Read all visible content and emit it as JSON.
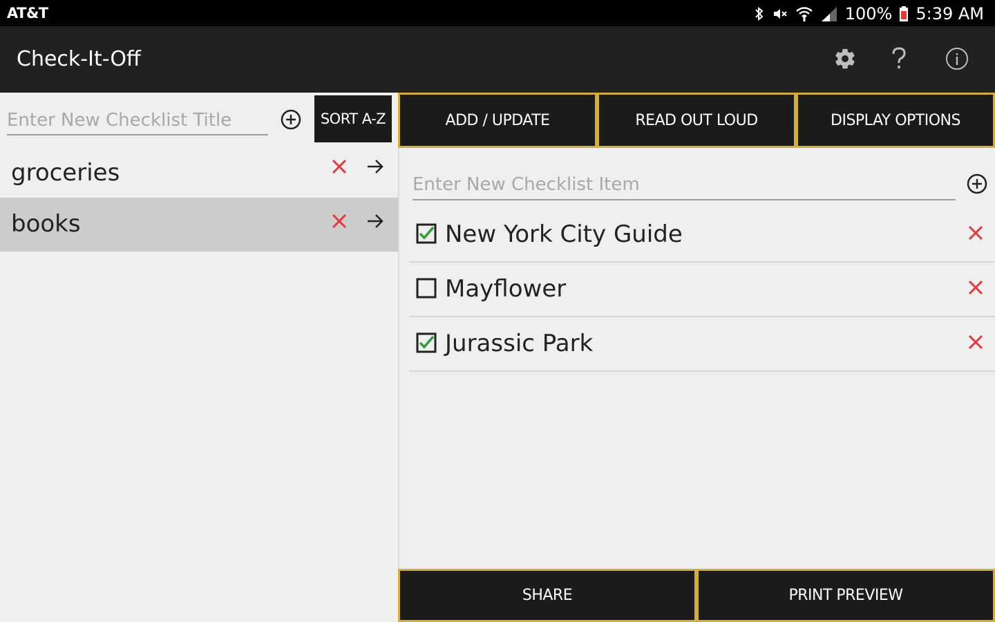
{
  "statusbar": {
    "carrier": "AT&T",
    "battery": "100%",
    "time": "5:39 AM",
    "icons": [
      "bluetooth-icon",
      "mute-icon",
      "wifi-icon",
      "signal-icon",
      "battery-icon"
    ]
  },
  "appbar": {
    "title": "Check-It-Off",
    "icons": [
      "gear-icon",
      "help-icon",
      "info-icon"
    ]
  },
  "left_pane": {
    "title_input": {
      "placeholder": "Enter New Checklist Title",
      "value": ""
    },
    "sort_label": "SORT A-Z",
    "checklists": [
      {
        "label": "groceries",
        "selected": false
      },
      {
        "label": "books",
        "selected": true
      }
    ]
  },
  "right_pane": {
    "tabs": [
      {
        "label": "ADD / UPDATE"
      },
      {
        "label": "READ OUT LOUD"
      },
      {
        "label": "DISPLAY OPTIONS"
      }
    ],
    "item_input": {
      "placeholder": "Enter New Checklist Item",
      "value": ""
    },
    "items": [
      {
        "label": "New York City Guide",
        "checked": true
      },
      {
        "label": "Mayflower",
        "checked": false
      },
      {
        "label": "Jurassic Park",
        "checked": true
      }
    ],
    "bottom_buttons": [
      {
        "label": "SHARE"
      },
      {
        "label": "PRINT PREVIEW"
      }
    ]
  },
  "colors": {
    "status_bar": "#000000",
    "app_bar": "#212121",
    "button_bg": "#1b1b1b",
    "button_border": "#d4af37",
    "delete_red": "#e53935",
    "check_green": "#2e9e3a",
    "selected_row": "#cccccc",
    "background": "#efefef"
  }
}
